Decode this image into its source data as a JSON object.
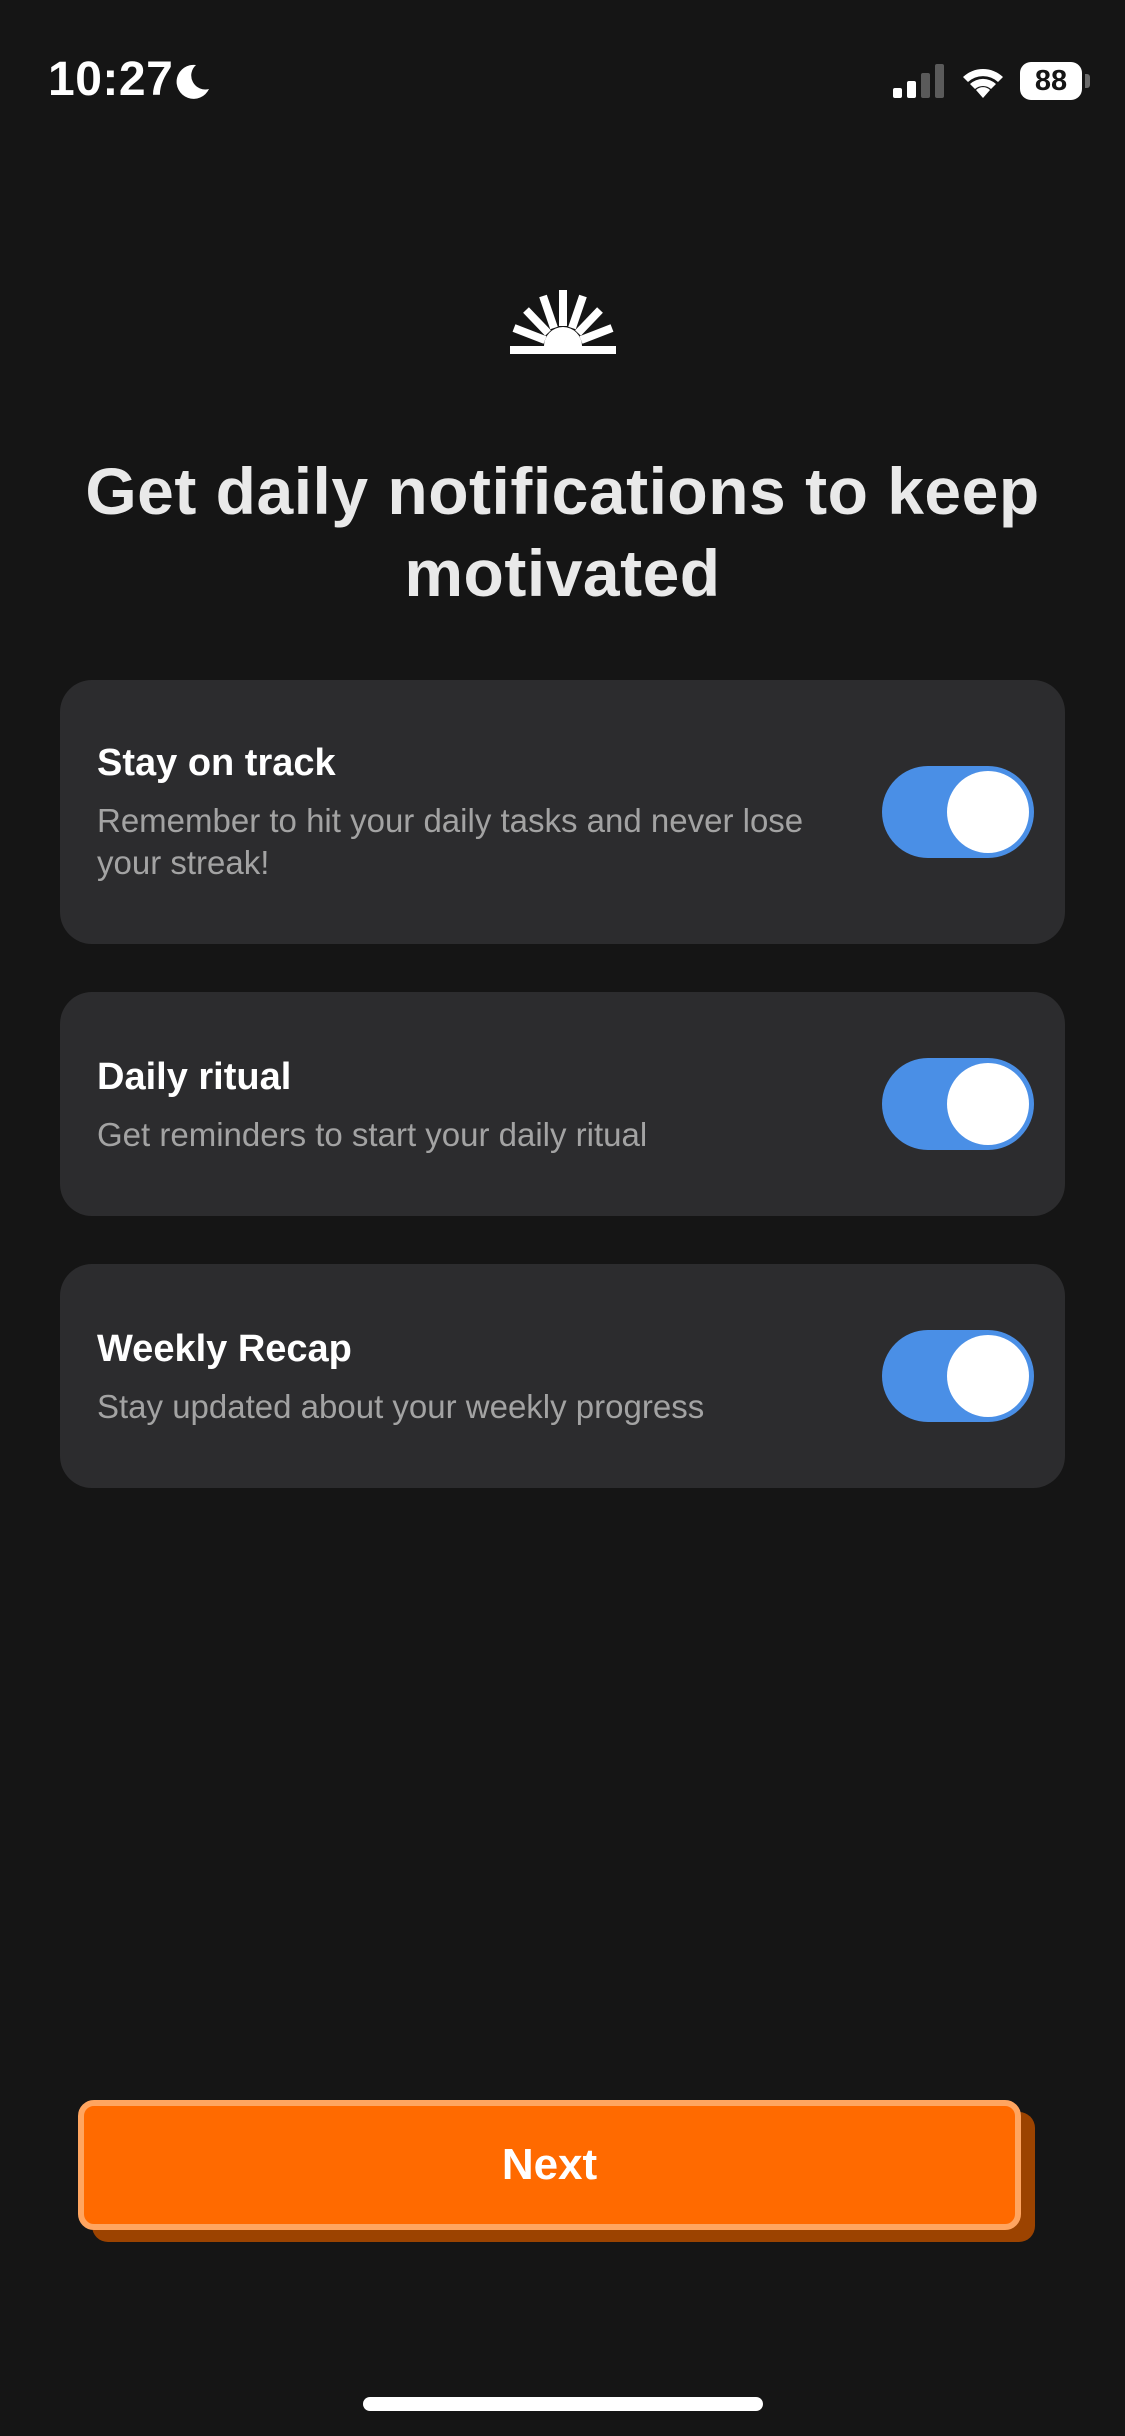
{
  "status_bar": {
    "time": "10:27",
    "battery_level": "88",
    "icons": [
      "moon-icon",
      "signal-icon",
      "wifi-icon",
      "battery-icon"
    ]
  },
  "header": {
    "logo_icon": "sun-rays-icon",
    "title": "Get daily notifications to keep motivated"
  },
  "options": [
    {
      "title": "Stay on track",
      "description": "Remember to hit your daily tasks and never lose your streak!",
      "enabled": true
    },
    {
      "title": "Daily ritual",
      "description": "Get reminders to start your daily ritual",
      "enabled": true
    },
    {
      "title": "Weekly Recap",
      "description": "Stay updated about your weekly progress",
      "enabled": true
    }
  ],
  "next_button": {
    "label": "Next"
  },
  "colors": {
    "background": "#151515",
    "card": "#2c2c2e",
    "toggle_on": "#4a8fe6",
    "accent": "#ff6a00",
    "accent_border": "#ffa560"
  }
}
